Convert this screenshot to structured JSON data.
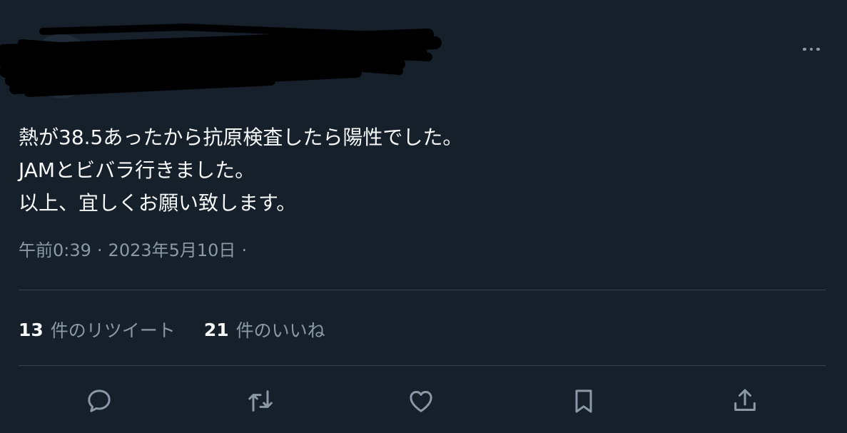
{
  "tweet": {
    "body_lines": [
      "熱が38.5あったから抗原検査したら陽性でした。",
      "JAMとビバラ行きました。",
      "以上、宜しくお願い致します。"
    ],
    "time": "午前0:39",
    "date": "2023年5月10日",
    "separator": "·"
  },
  "stats": {
    "retweets_count": "13",
    "retweets_label": "件のリツイート",
    "likes_count": "21",
    "likes_label": "件のいいね"
  },
  "icons": {
    "more": "more-icon",
    "reply": "reply-icon",
    "retweet": "retweet-icon",
    "like": "heart-icon",
    "bookmark": "bookmark-icon",
    "share": "share-icon"
  },
  "colors": {
    "background": "#15202b",
    "text": "#f7f9f9",
    "secondary_text": "#8b98a5",
    "divider": "#38444d"
  }
}
